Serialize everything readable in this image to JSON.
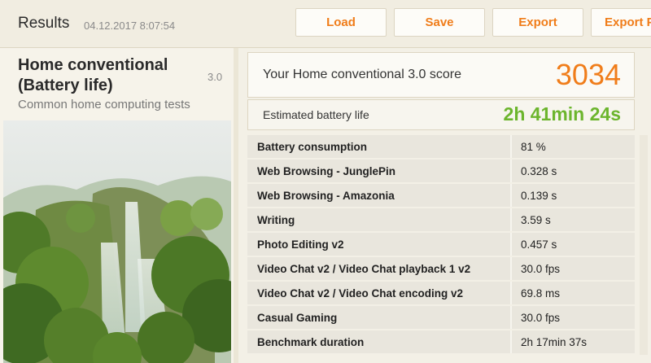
{
  "header": {
    "title": "Results",
    "timestamp": "04.12.2017 8:07:54",
    "buttons": {
      "load": "Load",
      "save": "Save",
      "export": "Export",
      "export_pdf": "Export PDF"
    }
  },
  "benchmark": {
    "name_line1": "Home conventional",
    "name_line2": "(Battery life)",
    "version": "3.0",
    "description": "Common home computing tests"
  },
  "score": {
    "label": "Your Home conventional 3.0 score",
    "value": "3034"
  },
  "battery": {
    "label": "Estimated battery life",
    "value": "2h 41min 24s"
  },
  "results": [
    {
      "name": "Battery consumption",
      "value": "81 %"
    },
    {
      "name": "Web Browsing - JunglePin",
      "value": "0.328 s"
    },
    {
      "name": "Web Browsing - Amazonia",
      "value": "0.139 s"
    },
    {
      "name": "Writing",
      "value": "3.59 s"
    },
    {
      "name": "Photo Editing v2",
      "value": "0.457 s"
    },
    {
      "name": "Video Chat v2 / Video Chat playback 1 v2",
      "value": "30.0 fps"
    },
    {
      "name": "Video Chat v2 / Video Chat encoding v2",
      "value": "69.8 ms"
    },
    {
      "name": "Casual Gaming",
      "value": "30.0 fps"
    },
    {
      "name": "Benchmark duration",
      "value": "2h 17min 37s"
    }
  ],
  "colors": {
    "accent": "#f07d1a",
    "battery_green": "#6cb52d"
  }
}
